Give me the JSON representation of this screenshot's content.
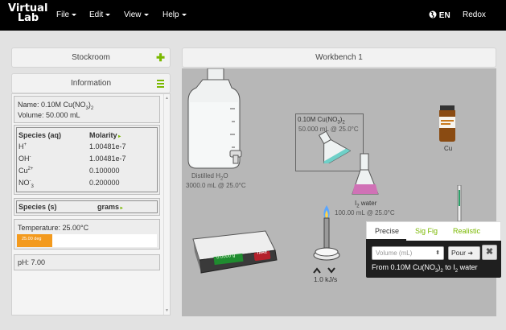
{
  "nav": {
    "logo_line1": "Virtual",
    "logo_line2": "Lab",
    "menus": [
      "File",
      "Edit",
      "View",
      "Help"
    ],
    "language": "EN",
    "redox": "Redox"
  },
  "stockroom": {
    "title": "Stockroom"
  },
  "information": {
    "title": "Information",
    "name_label": "Name: 0.10M Cu(NO",
    "name_sub": "3",
    "name_end": ")",
    "name_sub2": "2",
    "volume": "Volume: 50.000 mL",
    "species_aq_header": "Species (aq)",
    "molarity_header": "Molarity",
    "species": [
      {
        "name": "H",
        "sup": "+",
        "sub": "",
        "value": "1.00481e-7"
      },
      {
        "name": "OH",
        "sup": "-",
        "sub": "",
        "value": "1.00481e-7"
      },
      {
        "name": "Cu",
        "sup": "2+",
        "sub": "",
        "value": "0.100000"
      },
      {
        "name": "NO",
        "sup": "-",
        "sub": "3",
        "value": "0.200000"
      }
    ],
    "species_s_header": "Species (s)",
    "grams_header": "grams",
    "temperature": "Temperature: 25.00°C",
    "temperature_bar": "25.00 deg",
    "temperature_fraction": 0.25,
    "ph": "pH: 7.00"
  },
  "workbench": {
    "title": "Workbench 1",
    "distilled_name": "Distilled H",
    "distilled_sub": "2",
    "distilled_end": "O",
    "distilled_info": "3000.0 mL @ 25.0°C",
    "flask1_name": "0.10M Cu(NO",
    "flask1_sub": "3",
    "flask1_end": ")",
    "flask1_sub2": "2",
    "flask1_info": "50.000 mL @ 25.0°C",
    "flask2_name": "I",
    "flask2_sub": "2",
    "flask2_end": " water",
    "flask2_info": "100.00 mL @ 25.0°C",
    "cu_label": "Cu",
    "scale_reading": "0.0000 g",
    "tare_label": "TARE",
    "burner_rate": "1.0 kJ/s"
  },
  "pour_popup": {
    "tabs": [
      "Precise",
      "Sig Fig",
      "Realistic"
    ],
    "volume_placeholder": "Volume (mL)",
    "pour_label": "Pour",
    "close_label": "✖",
    "message_a": "From 0.10M Cu(NO",
    "message_sub": "3",
    "message_b": ")",
    "message_sub2": "2",
    "message_c": " to I",
    "message_sub3": "2",
    "message_d": " water"
  },
  "colors": {
    "accent": "#7ab800",
    "temperature_bar": "#f39a1e",
    "navbar": "#000000"
  }
}
